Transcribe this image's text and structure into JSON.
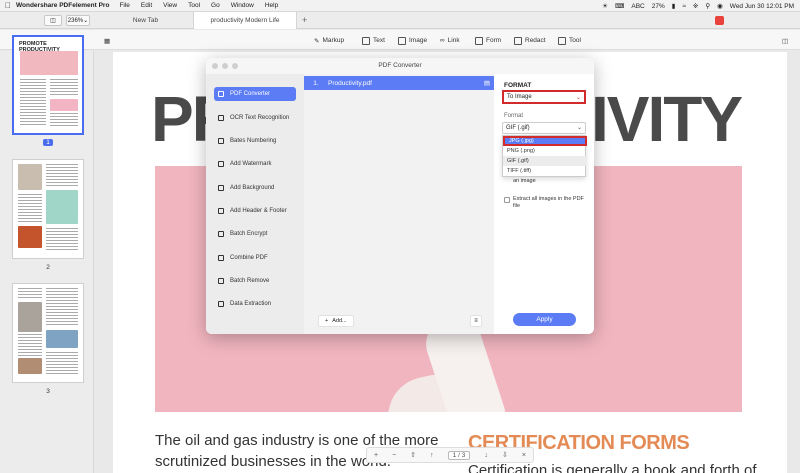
{
  "menubar": {
    "app": "Wondershare PDFelement Pro",
    "items": [
      "File",
      "Edit",
      "View",
      "Tool",
      "Go",
      "Window",
      "Help"
    ],
    "input_source": "ABC",
    "battery": "27%",
    "clock": "Wed Jun 30  12:01 PM"
  },
  "tabs": {
    "zoom": "236%",
    "tab1": "New Tab",
    "tab2": "productivity Modern Life",
    "plus": "+"
  },
  "toolbar": {
    "markup": "Markup",
    "text": "Text",
    "image": "Image",
    "link": "Link",
    "form": "Form",
    "redact": "Redact",
    "tool": "Tool"
  },
  "thumbnails": {
    "title": "PROMOTE PRODUCTIVITY",
    "pages": [
      "1",
      "2",
      "3"
    ]
  },
  "document": {
    "title_left": "PR",
    "title_right": "TIVITY",
    "body": "The oil and gas industry is one of the more scrutinized businesses in the world. Primarily,",
    "cert_title": "CERTIFICATION FORMS",
    "cert_text": "Certification is generally a book and forth of"
  },
  "pagenav": {
    "current": "1",
    "separator": "/",
    "total": "3"
  },
  "dialog": {
    "title": "PDF Converter",
    "sidebar": [
      "PDF Converter",
      "OCR Text Recognition",
      "Bates Numbering",
      "Add Watermark",
      "Add Background",
      "Add Header & Footer",
      "Batch Encrypt",
      "Combine PDF",
      "Batch Remove",
      "Data Extraction"
    ],
    "file": {
      "index": "1.",
      "name": "Productivity.pdf"
    },
    "add_label": "Add...",
    "format_heading": "FORMAT",
    "format_select": "To Image",
    "format_label": "Format",
    "format_value": "GIF (.gif)",
    "options": [
      "JPG (.jpg)",
      "PNG (.png)",
      "GIF (.gif)",
      "TIFF (.tiff)"
    ],
    "check1": "an image",
    "check2": "Extract all images in the PDF file",
    "apply": "Apply"
  },
  "colors": {
    "accent": "#5b7cf5",
    "highlight_box": "#d12b2b",
    "hero_pink": "#f1b5bf",
    "cert_orange": "#e38a55"
  }
}
